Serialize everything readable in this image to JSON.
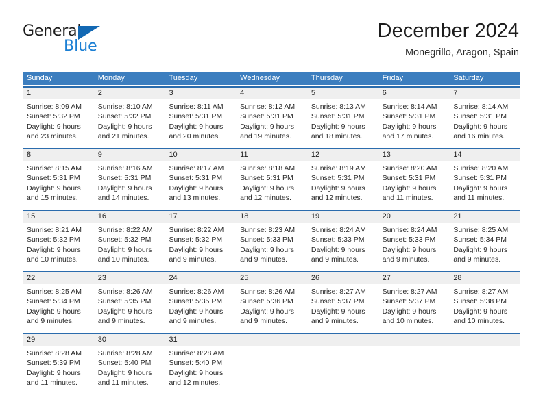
{
  "brand": {
    "name_part1": "General",
    "name_part2": "Blue",
    "triangle_color": "#1268b3",
    "blue_text_color": "#1b7fd4"
  },
  "header": {
    "title": "December 2024",
    "subtitle": "Monegrillo, Aragon, Spain"
  },
  "theme": {
    "header_row_bg": "#3c7ebf",
    "row_top_border": "#2b6cad",
    "day_number_band_bg": "#efefef",
    "text_color": "#2a2a2a"
  },
  "calendar": {
    "weekday_headers": [
      "Sunday",
      "Monday",
      "Tuesday",
      "Wednesday",
      "Thursday",
      "Friday",
      "Saturday"
    ],
    "weeks": [
      [
        {
          "day": "1",
          "lines": [
            "Sunrise: 8:09 AM",
            "Sunset: 5:32 PM",
            "Daylight: 9 hours",
            "and 23 minutes."
          ]
        },
        {
          "day": "2",
          "lines": [
            "Sunrise: 8:10 AM",
            "Sunset: 5:32 PM",
            "Daylight: 9 hours",
            "and 21 minutes."
          ]
        },
        {
          "day": "3",
          "lines": [
            "Sunrise: 8:11 AM",
            "Sunset: 5:31 PM",
            "Daylight: 9 hours",
            "and 20 minutes."
          ]
        },
        {
          "day": "4",
          "lines": [
            "Sunrise: 8:12 AM",
            "Sunset: 5:31 PM",
            "Daylight: 9 hours",
            "and 19 minutes."
          ]
        },
        {
          "day": "5",
          "lines": [
            "Sunrise: 8:13 AM",
            "Sunset: 5:31 PM",
            "Daylight: 9 hours",
            "and 18 minutes."
          ]
        },
        {
          "day": "6",
          "lines": [
            "Sunrise: 8:14 AM",
            "Sunset: 5:31 PM",
            "Daylight: 9 hours",
            "and 17 minutes."
          ]
        },
        {
          "day": "7",
          "lines": [
            "Sunrise: 8:14 AM",
            "Sunset: 5:31 PM",
            "Daylight: 9 hours",
            "and 16 minutes."
          ]
        }
      ],
      [
        {
          "day": "8",
          "lines": [
            "Sunrise: 8:15 AM",
            "Sunset: 5:31 PM",
            "Daylight: 9 hours",
            "and 15 minutes."
          ]
        },
        {
          "day": "9",
          "lines": [
            "Sunrise: 8:16 AM",
            "Sunset: 5:31 PM",
            "Daylight: 9 hours",
            "and 14 minutes."
          ]
        },
        {
          "day": "10",
          "lines": [
            "Sunrise: 8:17 AM",
            "Sunset: 5:31 PM",
            "Daylight: 9 hours",
            "and 13 minutes."
          ]
        },
        {
          "day": "11",
          "lines": [
            "Sunrise: 8:18 AM",
            "Sunset: 5:31 PM",
            "Daylight: 9 hours",
            "and 12 minutes."
          ]
        },
        {
          "day": "12",
          "lines": [
            "Sunrise: 8:19 AM",
            "Sunset: 5:31 PM",
            "Daylight: 9 hours",
            "and 12 minutes."
          ]
        },
        {
          "day": "13",
          "lines": [
            "Sunrise: 8:20 AM",
            "Sunset: 5:31 PM",
            "Daylight: 9 hours",
            "and 11 minutes."
          ]
        },
        {
          "day": "14",
          "lines": [
            "Sunrise: 8:20 AM",
            "Sunset: 5:31 PM",
            "Daylight: 9 hours",
            "and 11 minutes."
          ]
        }
      ],
      [
        {
          "day": "15",
          "lines": [
            "Sunrise: 8:21 AM",
            "Sunset: 5:32 PM",
            "Daylight: 9 hours",
            "and 10 minutes."
          ]
        },
        {
          "day": "16",
          "lines": [
            "Sunrise: 8:22 AM",
            "Sunset: 5:32 PM",
            "Daylight: 9 hours",
            "and 10 minutes."
          ]
        },
        {
          "day": "17",
          "lines": [
            "Sunrise: 8:22 AM",
            "Sunset: 5:32 PM",
            "Daylight: 9 hours",
            "and 9 minutes."
          ]
        },
        {
          "day": "18",
          "lines": [
            "Sunrise: 8:23 AM",
            "Sunset: 5:33 PM",
            "Daylight: 9 hours",
            "and 9 minutes."
          ]
        },
        {
          "day": "19",
          "lines": [
            "Sunrise: 8:24 AM",
            "Sunset: 5:33 PM",
            "Daylight: 9 hours",
            "and 9 minutes."
          ]
        },
        {
          "day": "20",
          "lines": [
            "Sunrise: 8:24 AM",
            "Sunset: 5:33 PM",
            "Daylight: 9 hours",
            "and 9 minutes."
          ]
        },
        {
          "day": "21",
          "lines": [
            "Sunrise: 8:25 AM",
            "Sunset: 5:34 PM",
            "Daylight: 9 hours",
            "and 9 minutes."
          ]
        }
      ],
      [
        {
          "day": "22",
          "lines": [
            "Sunrise: 8:25 AM",
            "Sunset: 5:34 PM",
            "Daylight: 9 hours",
            "and 9 minutes."
          ]
        },
        {
          "day": "23",
          "lines": [
            "Sunrise: 8:26 AM",
            "Sunset: 5:35 PM",
            "Daylight: 9 hours",
            "and 9 minutes."
          ]
        },
        {
          "day": "24",
          "lines": [
            "Sunrise: 8:26 AM",
            "Sunset: 5:35 PM",
            "Daylight: 9 hours",
            "and 9 minutes."
          ]
        },
        {
          "day": "25",
          "lines": [
            "Sunrise: 8:26 AM",
            "Sunset: 5:36 PM",
            "Daylight: 9 hours",
            "and 9 minutes."
          ]
        },
        {
          "day": "26",
          "lines": [
            "Sunrise: 8:27 AM",
            "Sunset: 5:37 PM",
            "Daylight: 9 hours",
            "and 9 minutes."
          ]
        },
        {
          "day": "27",
          "lines": [
            "Sunrise: 8:27 AM",
            "Sunset: 5:37 PM",
            "Daylight: 9 hours",
            "and 10 minutes."
          ]
        },
        {
          "day": "28",
          "lines": [
            "Sunrise: 8:27 AM",
            "Sunset: 5:38 PM",
            "Daylight: 9 hours",
            "and 10 minutes."
          ]
        }
      ],
      [
        {
          "day": "29",
          "lines": [
            "Sunrise: 8:28 AM",
            "Sunset: 5:39 PM",
            "Daylight: 9 hours",
            "and 11 minutes."
          ]
        },
        {
          "day": "30",
          "lines": [
            "Sunrise: 8:28 AM",
            "Sunset: 5:40 PM",
            "Daylight: 9 hours",
            "and 11 minutes."
          ]
        },
        {
          "day": "31",
          "lines": [
            "Sunrise: 8:28 AM",
            "Sunset: 5:40 PM",
            "Daylight: 9 hours",
            "and 12 minutes."
          ]
        },
        {
          "day": "",
          "lines": []
        },
        {
          "day": "",
          "lines": []
        },
        {
          "day": "",
          "lines": []
        },
        {
          "day": "",
          "lines": []
        }
      ]
    ]
  }
}
